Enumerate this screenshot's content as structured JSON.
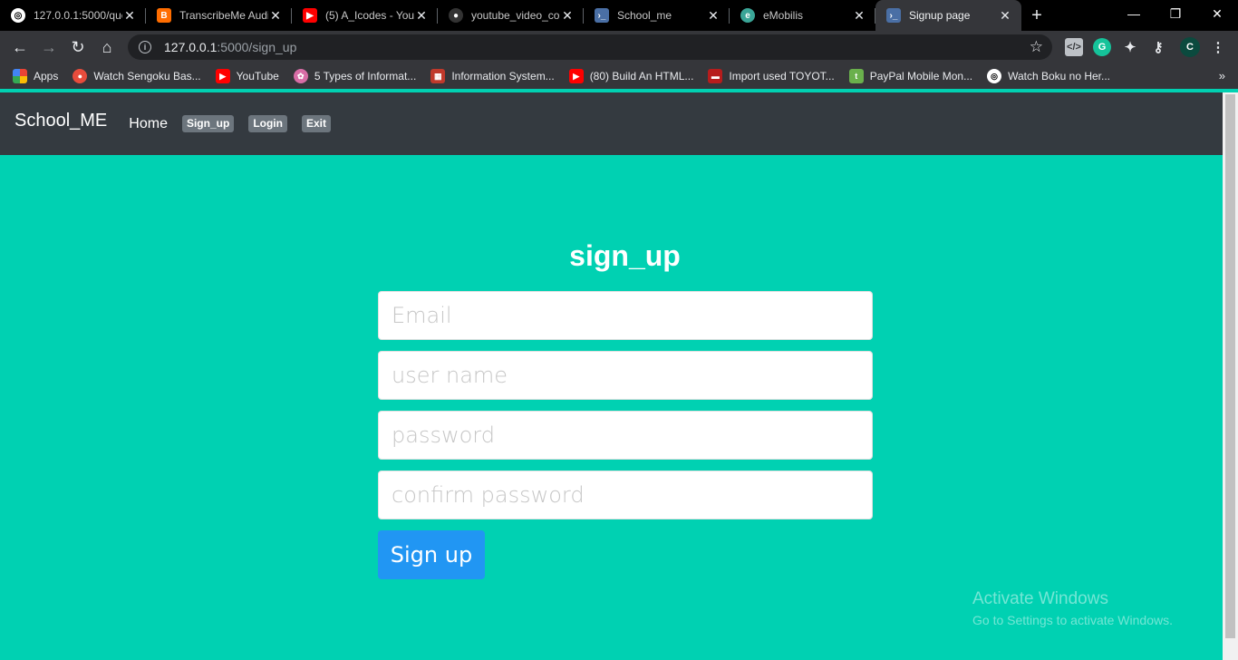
{
  "browser": {
    "tabs": [
      {
        "title": "127.0.0.1:5000/que",
        "icon": "globe-icon",
        "color": "#ffffff"
      },
      {
        "title": "TranscribeMe Audi",
        "icon": "blogger-icon",
        "color": "#ff6d00"
      },
      {
        "title": "(5) A_Icodes - YouT",
        "icon": "youtube-icon",
        "color": "#ff0000"
      },
      {
        "title": "youtube_video_co",
        "icon": "github-icon",
        "color": "#333333"
      },
      {
        "title": "School_me",
        "icon": "terminal-icon",
        "color": "#4a6fa5"
      },
      {
        "title": "eMobilis",
        "icon": "emobilis-icon",
        "color": "#3aa597"
      },
      {
        "title": "Signup page",
        "icon": "terminal-icon",
        "color": "#4a6fa5",
        "active": true
      }
    ],
    "new_tab_label": "+",
    "url_host": "127.0.0.1",
    "url_path": ":5000/sign_up",
    "bookmarks": [
      {
        "label": "Apps",
        "icon": "apps-icon"
      },
      {
        "label": "Watch Sengoku Bas...",
        "icon": "anime-icon"
      },
      {
        "label": "YouTube",
        "icon": "youtube-icon"
      },
      {
        "label": "5 Types of Informat...",
        "icon": "site-icon"
      },
      {
        "label": "Information System...",
        "icon": "site-icon"
      },
      {
        "label": "(80) Build An HTML...",
        "icon": "youtube-icon"
      },
      {
        "label": "Import used TOYOT...",
        "icon": "car-icon"
      },
      {
        "label": "PayPal Mobile Mon...",
        "icon": "tumblr-icon"
      },
      {
        "label": "Watch Boku no Her...",
        "icon": "globe-icon"
      }
    ],
    "profile_initial": "C"
  },
  "navbar": {
    "brand": "School_ME",
    "home": "Home",
    "signup": "Sign_up",
    "login": "Login",
    "exit": "Exit"
  },
  "form": {
    "title": "sign_up",
    "email_placeholder": "Email",
    "username_placeholder": "user name",
    "password_placeholder": "password",
    "confirm_placeholder": "confirm password",
    "submit_label": "Sign up"
  },
  "watermark": {
    "line1": "Activate Windows",
    "line2": "Go to Settings to activate Windows."
  },
  "colors": {
    "page_bg": "#00d1b2",
    "navbar_bg": "#343a40",
    "button_bg": "#2196f3",
    "badge_bg": "#6c757d"
  }
}
